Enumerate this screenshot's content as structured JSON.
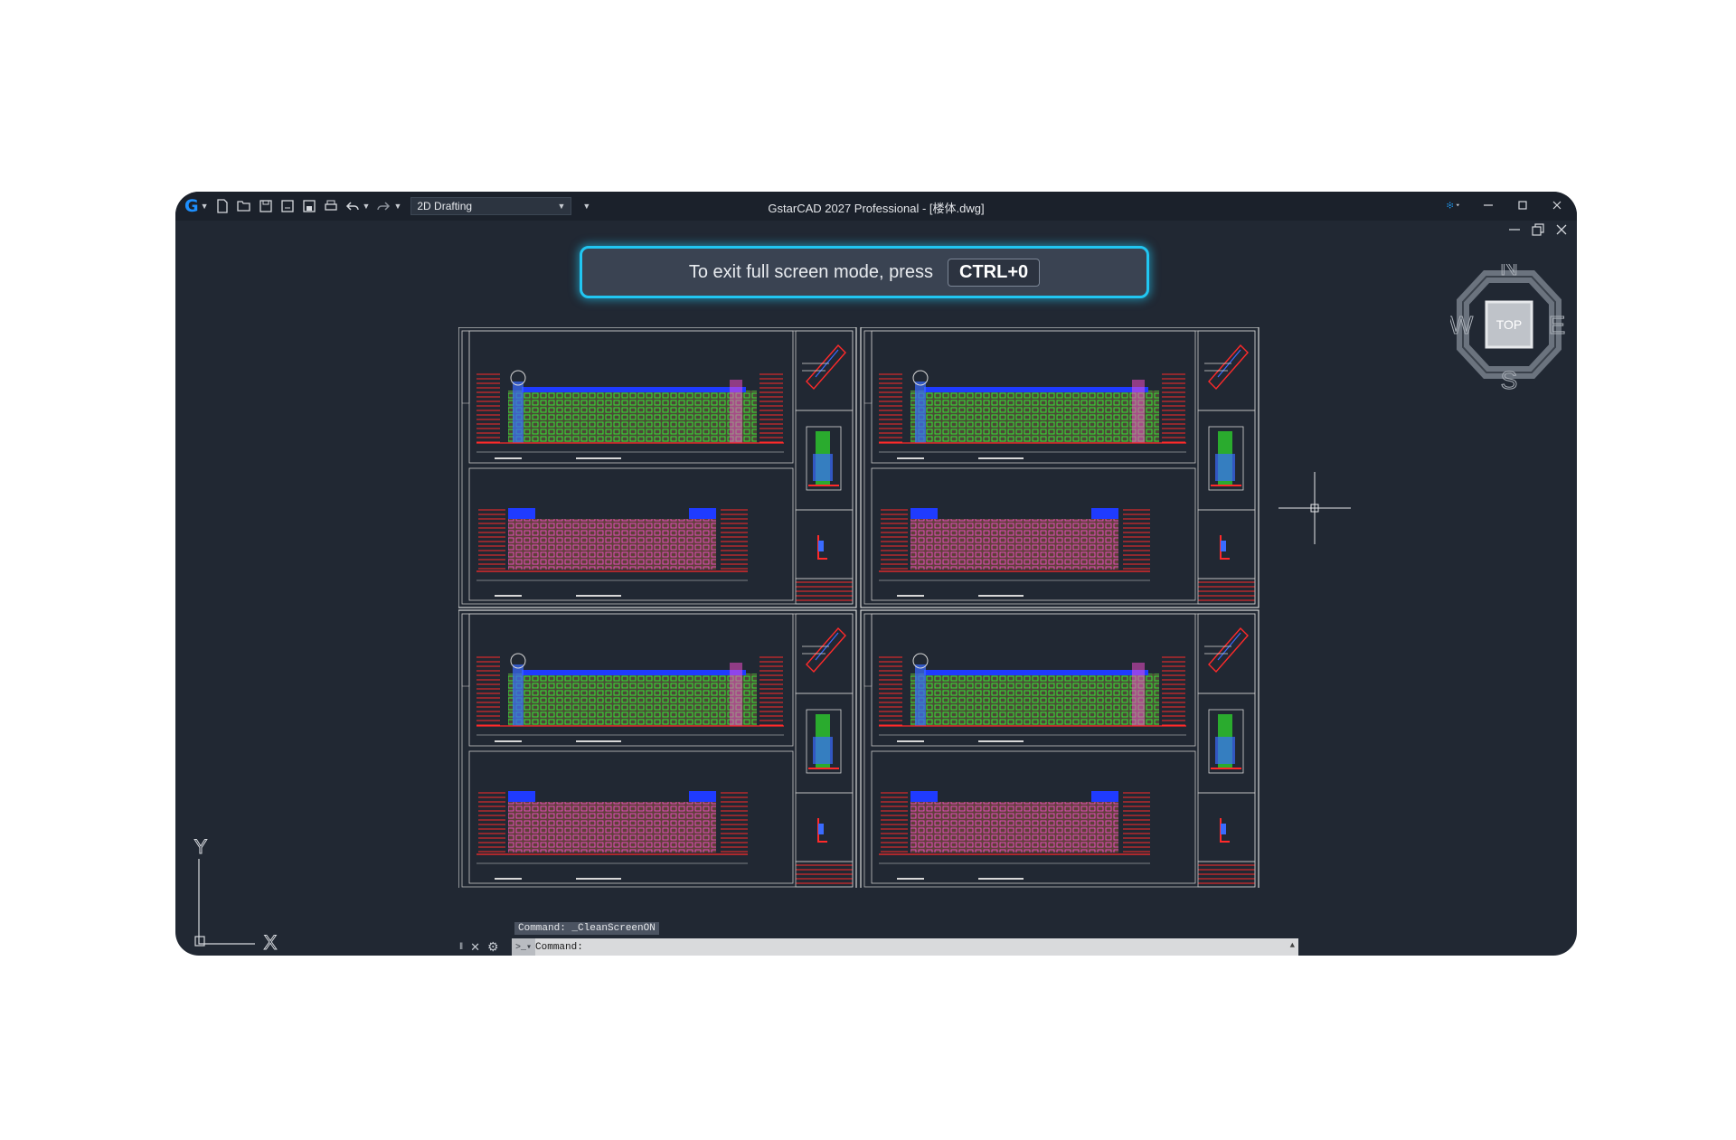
{
  "app": {
    "title": "GstarCAD 2027 Professional - [楼体.dwg]",
    "workspace": "2D Drafting"
  },
  "banner": {
    "message": "To exit full screen mode, press",
    "shortcut": "CTRL+0"
  },
  "viewcube": {
    "face": "TOP",
    "north": "N",
    "south": "S",
    "east": "E",
    "west": "W"
  },
  "ucs": {
    "x_label": "X",
    "y_label": "Y"
  },
  "command": {
    "history": "Command: _CleanScreenON",
    "prompt": "Command:"
  },
  "colors": {
    "canvas": "#212833",
    "accent": "#21c6f2",
    "logo": "#1e90ff"
  },
  "icons": [
    "app-logo-icon",
    "new-file-icon",
    "open-file-icon",
    "save-icon",
    "save-as-icon",
    "publish-icon",
    "print-icon",
    "undo-icon",
    "redo-icon",
    "minimize-icon",
    "maximize-icon",
    "close-icon",
    "settings-icon"
  ]
}
